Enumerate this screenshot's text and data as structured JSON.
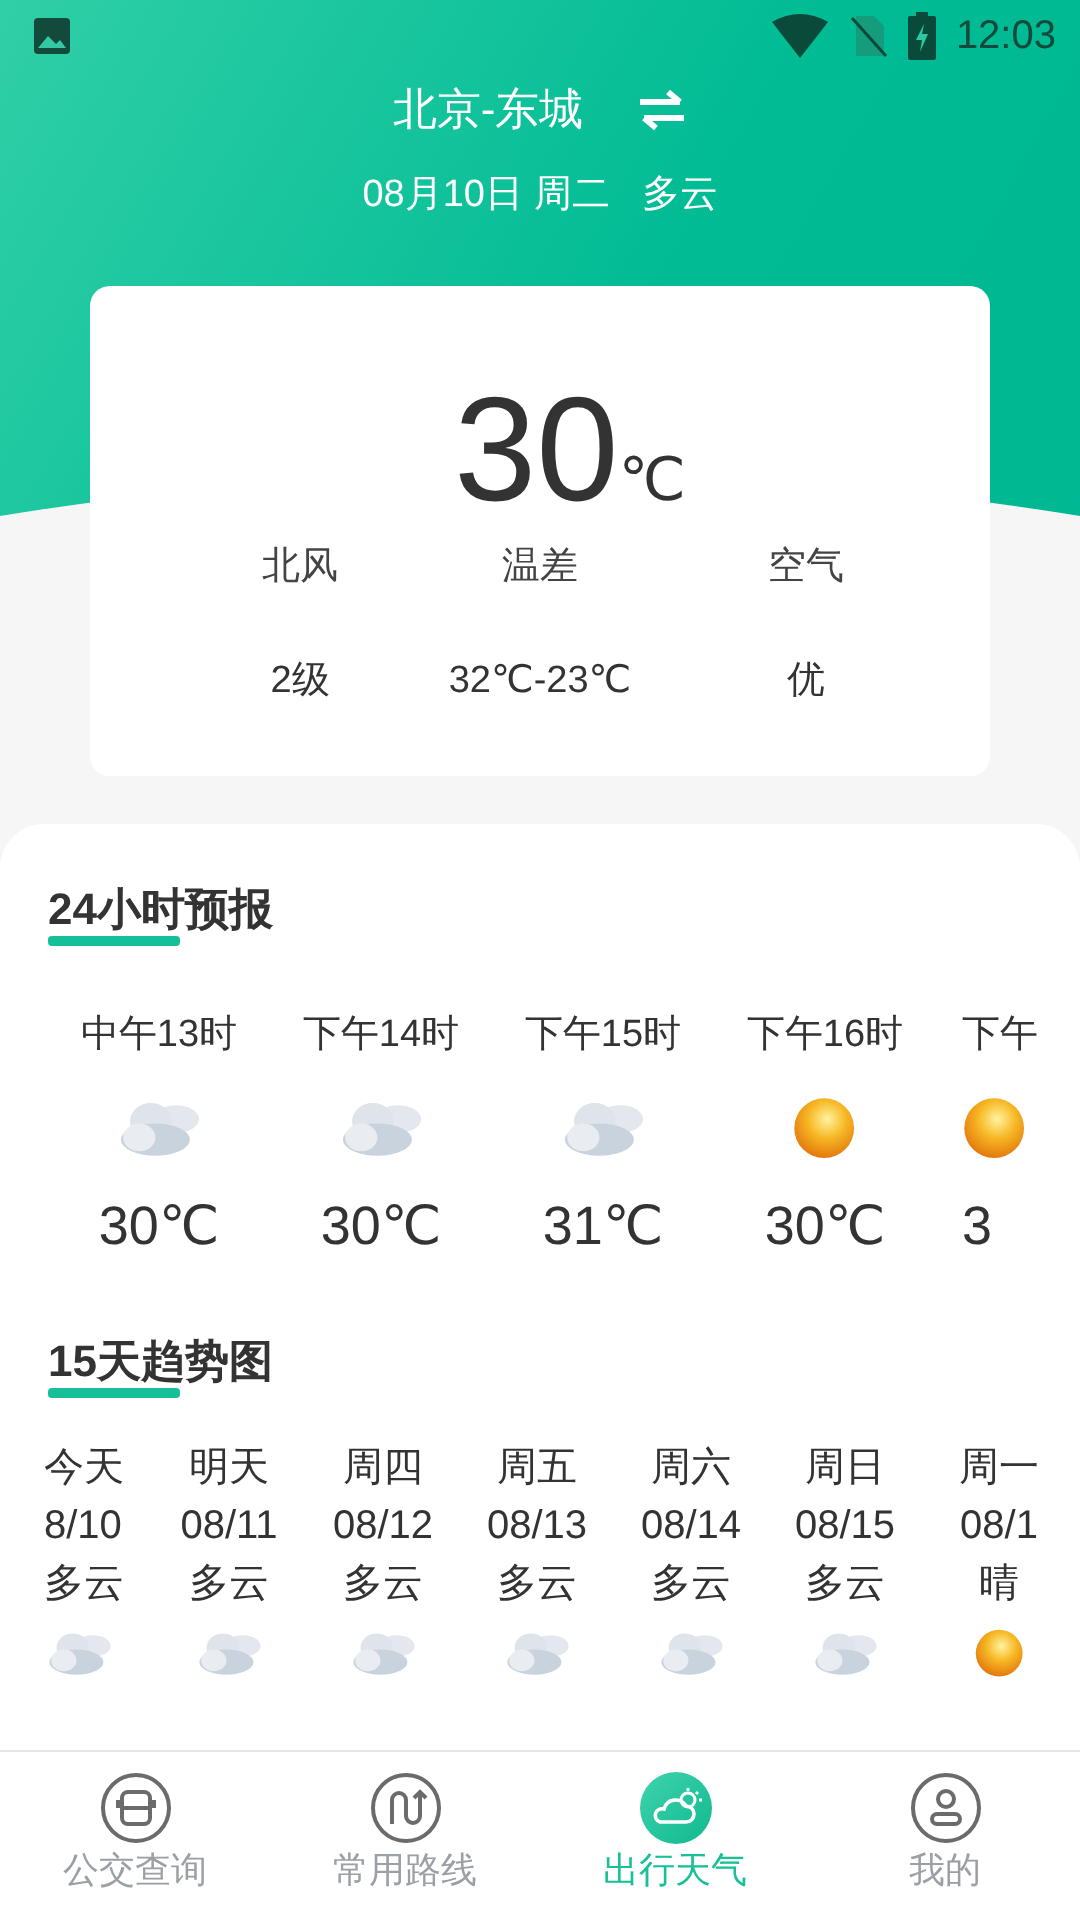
{
  "status_bar": {
    "time": "12:03"
  },
  "header": {
    "city": "北京-东城",
    "date": "08月10日 周二",
    "weather": "多云"
  },
  "current": {
    "temperature": "30",
    "unit": "℃",
    "stats": [
      {
        "label": "北风",
        "value": "2级"
      },
      {
        "label": "温差",
        "value": "32℃-23℃"
      },
      {
        "label": "空气",
        "value": "优"
      }
    ]
  },
  "hourly": {
    "title": "24小时预报",
    "items": [
      {
        "time": "中午13时",
        "kind": "cloudy",
        "temp": "30℃"
      },
      {
        "time": "下午14时",
        "kind": "cloudy",
        "temp": "30℃"
      },
      {
        "time": "下午15时",
        "kind": "cloudy",
        "temp": "31℃"
      },
      {
        "time": "下午16时",
        "kind": "sunny",
        "temp": "30℃"
      },
      {
        "time": "下午",
        "kind": "sunny",
        "temp": "3"
      }
    ]
  },
  "daily": {
    "title": "15天趋势图",
    "items": [
      {
        "day": "今天",
        "date": "8/10",
        "weather": "多云",
        "kind": "cloudy"
      },
      {
        "day": "明天",
        "date": "08/11",
        "weather": "多云",
        "kind": "cloudy"
      },
      {
        "day": "周四",
        "date": "08/12",
        "weather": "多云",
        "kind": "cloudy"
      },
      {
        "day": "周五",
        "date": "08/13",
        "weather": "多云",
        "kind": "cloudy"
      },
      {
        "day": "周六",
        "date": "08/14",
        "weather": "多云",
        "kind": "cloudy"
      },
      {
        "day": "周日",
        "date": "08/15",
        "weather": "多云",
        "kind": "cloudy"
      },
      {
        "day": "周一",
        "date": "08/1",
        "weather": "晴",
        "kind": "sunny"
      }
    ]
  },
  "nav": [
    {
      "label": "公交查询",
      "kind": "bus",
      "selected": false
    },
    {
      "label": "常用路线",
      "kind": "route",
      "selected": false
    },
    {
      "label": "出行天气",
      "kind": "weather",
      "selected": true
    },
    {
      "label": "我的",
      "kind": "person",
      "selected": false
    }
  ]
}
